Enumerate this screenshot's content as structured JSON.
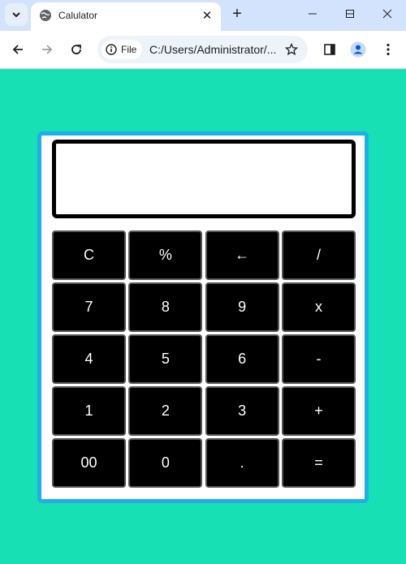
{
  "browser": {
    "tab_title": "Calulator",
    "new_tab_symbol": "+",
    "close_symbol": "✕",
    "site_chip_label": "File",
    "url": "C:/Users/Administrator/..."
  },
  "calculator": {
    "display_value": "",
    "keys": [
      [
        "C",
        "%",
        "←",
        "/"
      ],
      [
        "7",
        "8",
        "9",
        "x"
      ],
      [
        "4",
        "5",
        "6",
        "-"
      ],
      [
        "1",
        "2",
        "3",
        "+"
      ],
      [
        "00",
        "0",
        ".",
        "="
      ]
    ]
  },
  "colors": {
    "page_background": "#18e0b5",
    "calculator_border": "#1faee9",
    "key_background": "#000000",
    "key_text": "#ffffff"
  }
}
